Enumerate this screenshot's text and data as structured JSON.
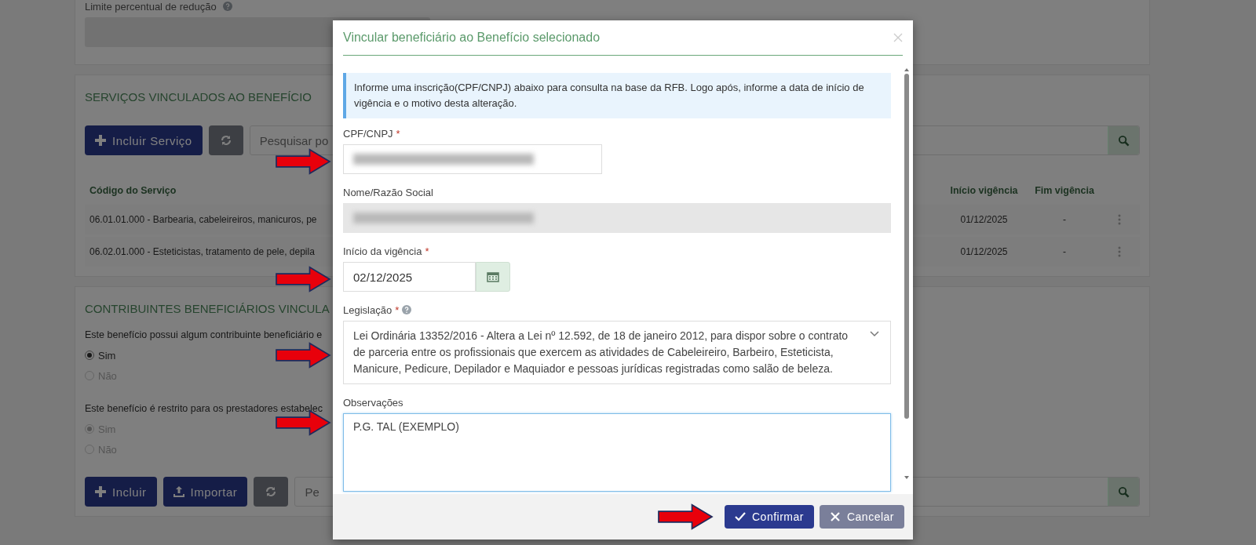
{
  "background_page": {
    "reduction_limit": {
      "label": "Limite percentual de redução",
      "help": true
    },
    "services_section": {
      "title": "SERVIÇOS VINCULADOS AO BENEFÍCIO",
      "toolbar": [
        {
          "kind": "add",
          "label": "Incluir Serviço"
        },
        {
          "kind": "refresh"
        }
      ],
      "search": {
        "placeholder": "Pesquisar po"
      },
      "table": {
        "columns": [
          "Código do Serviço",
          "Início vigência",
          "Fim vigência"
        ],
        "rows": [
          {
            "cells": [
              "06.01.01.000 - Barbearia, cabeleireiros, manicuros, pe",
              "01/12/2025",
              "-"
            ]
          },
          {
            "cells": [
              "06.02.01.000 - Esteticistas, tratamento de pele, depila",
              "01/12/2025",
              "-"
            ]
          }
        ]
      }
    },
    "beneficiaries_section": {
      "title": "CONTRIBUINTES BENEFICIÁRIOS VINCULA",
      "questions": [
        {
          "text": "Este benefício possui algum contribuinte beneficiário e",
          "options": [
            {
              "label": "Sim",
              "selected": true,
              "disabled": false
            },
            {
              "label": "Não",
              "selected": false,
              "disabled": true
            }
          ]
        },
        {
          "text": "Este benefício é restrito para os prestadores estabelec",
          "options": [
            {
              "label": "Sim",
              "selected": true,
              "disabled": true
            },
            {
              "label": "Não",
              "selected": false,
              "disabled": true
            }
          ]
        }
      ],
      "toolbar": [
        {
          "kind": "add",
          "label": "Incluir"
        },
        {
          "kind": "import",
          "label": "Importar"
        },
        {
          "kind": "refresh"
        }
      ],
      "search": {
        "placeholder": "Pe"
      }
    }
  },
  "modal": {
    "title": "Vincular beneficiário ao Benefício selecionado",
    "info": "Informe uma inscrição(CPF/CNPJ) abaixo para consulta na base da RFB. Logo após, informe a data de início de vigência e o motivo desta alteração.",
    "fields": [
      {
        "kind": "blurred",
        "label": "CPF/CNPJ",
        "required_mark": "*",
        "readonly": false,
        "arrow": true
      },
      {
        "kind": "blurred",
        "label": "Nome/Razão Social",
        "readonly": true
      },
      {
        "kind": "date",
        "label": "Início da vigência",
        "required_mark": "*",
        "value": "02/12/2025",
        "arrow": true
      },
      {
        "kind": "select",
        "label": "Legislação",
        "required_mark": "*",
        "help": true,
        "value": "Lei Ordinária 13352/2016 - Altera a Lei nº 12.592, de 18 de janeiro 2012, para dispor sobre o contrato de parceria entre os profissionais que exercem as atividades de Cabeleireiro, Barbeiro, Esteticista, Manicure, Pedicure, Depilador e Maquiador e pessoas jurídicas registradas como salão de beleza.",
        "arrow": true
      },
      {
        "kind": "textarea",
        "label": "Observações",
        "value": "P.G. TAL (EXEMPLO)",
        "focused": true,
        "arrow": true
      }
    ],
    "buttons": [
      {
        "kind": "confirm",
        "label": "Confirmar",
        "arrow": true
      },
      {
        "kind": "cancel",
        "label": "Cancelar"
      }
    ]
  }
}
